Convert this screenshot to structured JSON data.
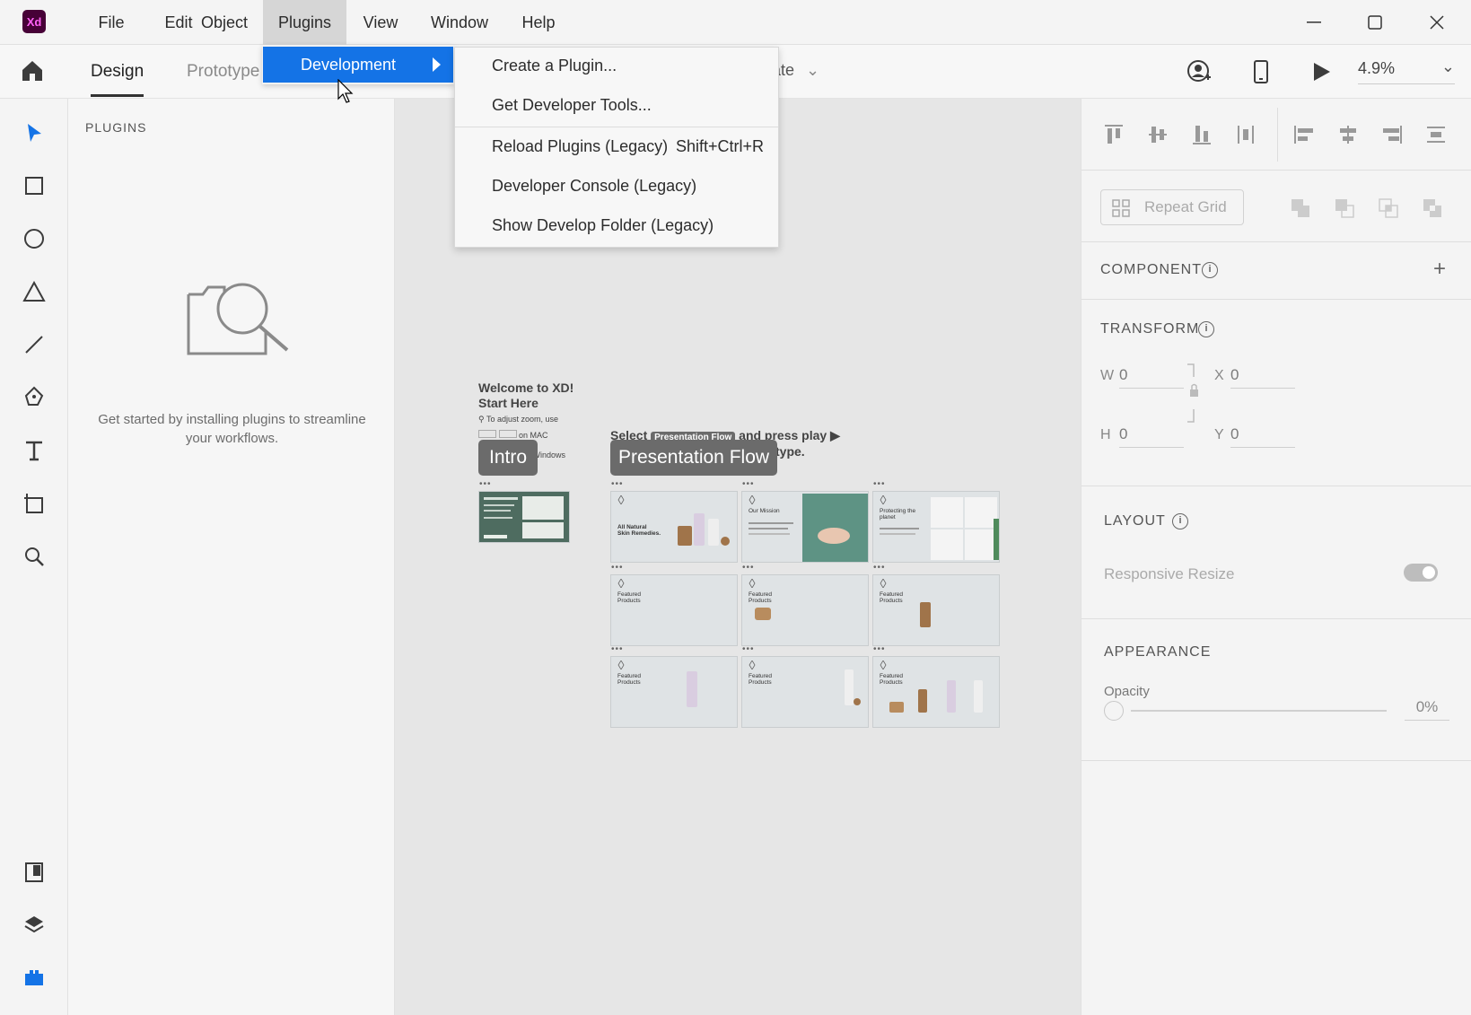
{
  "app": {
    "logo_text": "Xd"
  },
  "menubar": {
    "items": [
      "File",
      "Edit",
      "Object",
      "Plugins",
      "View",
      "Window",
      "Help"
    ],
    "active": "Plugins"
  },
  "toolbar": {
    "tabs": [
      "Design",
      "Prototype"
    ],
    "active_tab": "Design",
    "partial_label": "late",
    "zoom": "4.9%"
  },
  "plugins_menu": {
    "development_label": "Development",
    "submenu": [
      {
        "label": "Create a Plugin...",
        "shortcut": ""
      },
      {
        "label": "Get Developer Tools...",
        "shortcut": ""
      },
      {
        "label": "Reload Plugins (Legacy)",
        "shortcut": "Shift+Ctrl+R"
      },
      {
        "label": "Developer Console (Legacy)",
        "shortcut": ""
      },
      {
        "label": "Show Develop Folder (Legacy)",
        "shortcut": ""
      }
    ]
  },
  "plugins_panel": {
    "heading": "PLUGINS",
    "empty_text": "Get started by installing plugins to streamline your workflows."
  },
  "canvas": {
    "welcome_line1": "Welcome to XD!",
    "welcome_line2": "Start Here",
    "zoom_hint": "To adjust zoom, use",
    "on_mac": "on MAC",
    "on_windows": "n Windows",
    "select_text": "Select",
    "select_badge": "Presentation Flow",
    "press_play": "and press play ▶",
    "prototype_text": "type.",
    "intro_label": "Intro",
    "flow_label": "Presentation Flow",
    "artboards": [
      {
        "title": "All Natural\nSkin Remedies."
      },
      {
        "title": "Our Mission"
      },
      {
        "title": "Protecting the\nplanet"
      },
      {
        "title": "Featured\nProducts"
      },
      {
        "title": "Featured\nProducts"
      },
      {
        "title": "Featured\nProducts"
      },
      {
        "title": "Featured\nProducts"
      },
      {
        "title": "Featured\nProducts"
      },
      {
        "title": "Featured\nProducts"
      }
    ]
  },
  "rightpanel": {
    "repeat_grid": "Repeat Grid",
    "component": "COMPONENT",
    "transform": "TRANSFORM",
    "w_label": "W",
    "w_value": "0",
    "h_label": "H",
    "h_value": "0",
    "x_label": "X",
    "x_value": "0",
    "y_label": "Y",
    "y_value": "0",
    "layout": "LAYOUT",
    "responsive_resize": "Responsive Resize",
    "appearance": "APPEARANCE",
    "opacity_label": "Opacity",
    "opacity_value": "0%"
  },
  "colors": {
    "accent": "#1473e6",
    "logo_bg": "#470137",
    "logo_fg": "#ff61f6"
  }
}
